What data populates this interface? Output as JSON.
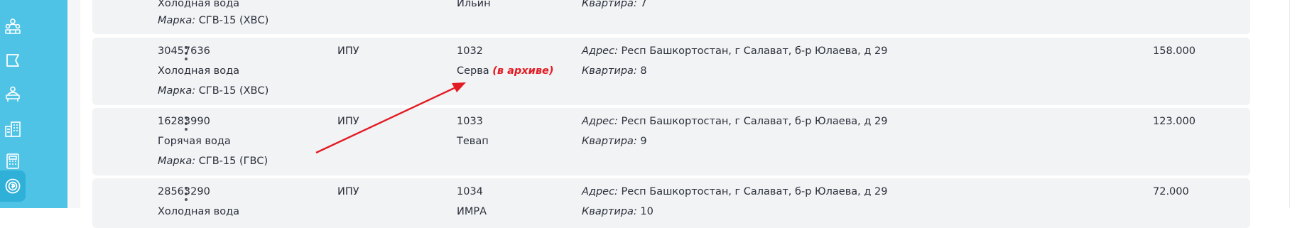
{
  "sidebar": {
    "items": [
      {
        "icon": "people-group-icon",
        "active": false
      },
      {
        "icon": "flag-icon",
        "active": false
      },
      {
        "icon": "user-desk-icon",
        "active": false
      },
      {
        "icon": "building-icon",
        "active": false
      },
      {
        "icon": "calculator-icon",
        "active": false
      },
      {
        "icon": "coin-icon",
        "active": true
      }
    ]
  },
  "labels": {
    "brand": "Марка:",
    "address": "Адрес:",
    "apartment": "Квартира:"
  },
  "rows": [
    {
      "resource": "Холодная вода",
      "brand": "СГВ-15 (ХВС)",
      "owner": "Ильин",
      "apartment": "7"
    },
    {
      "number": "30457636",
      "type": "ИПУ",
      "account": "1032",
      "resource": "Холодная вода",
      "owner": "Серва",
      "archived_note": "(в архиве)",
      "brand": "СГВ-15 (ХВС)",
      "address": "Респ Башкортостан, г Салават, б-р Юлаева, д 29",
      "apartment": "8",
      "value": "158.000"
    },
    {
      "number": "16283990",
      "type": "ИПУ",
      "account": "1033",
      "resource": "Горячая вода",
      "owner": "Тевап",
      "brand": "СГВ-15 (ГВС)",
      "address": "Респ Башкортостан, г Салават, б-р Юлаева, д 29",
      "apartment": "9",
      "value": "123.000"
    },
    {
      "number": "28563290",
      "type": "ИПУ",
      "account": "1034",
      "resource": "Холодная вода",
      "owner": "ИМРА",
      "address": "Респ Башкортостан, г Салават, б-р Юлаева, д 29",
      "apartment": "10",
      "value": "72.000"
    }
  ],
  "annotation": {
    "color": "#e31b23",
    "icon": "red-arrow-annotation"
  }
}
